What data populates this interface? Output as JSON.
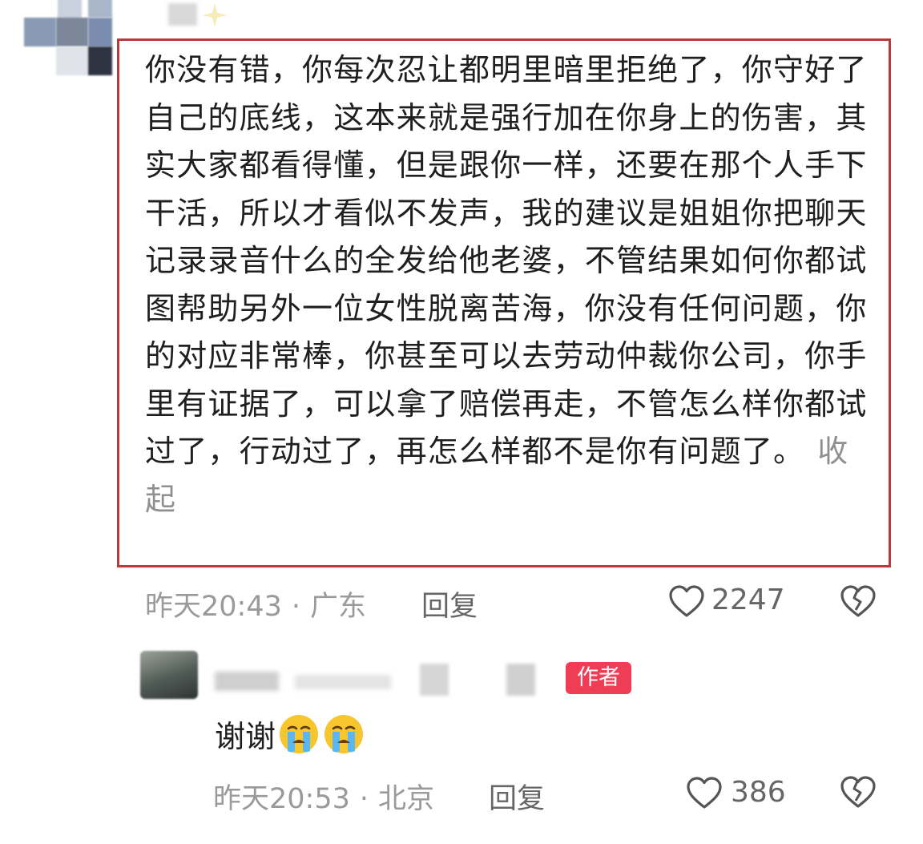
{
  "comment": {
    "text": "你没有错，你每次忍让都明里暗里拒绝了，你守好了自己的底线，这本来就是强行加在你身上的伤害，其实大家都看得懂，但是跟你一样，还要在那个人手下干活，所以才看似不发声，我的建议是姐姐你把聊天记录录音什么的全发给他老婆，不管结果如何你都试图帮助另外一位女性脱离苦海，你没有任何问题，你的对应非常棒，你甚至可以去劳动仲裁你公司，你手里有证据了，可以拿了赔偿再走，不管怎么样你都试过了，行动过了，再怎么样都不是你有问题了。",
    "collapse_label": "收起",
    "time": "昨天20:43",
    "separator": "·",
    "location": "广东",
    "reply_label": "回复",
    "like_count": "2247",
    "highlight_color": "#b83a3a"
  },
  "reply": {
    "badge": "作者",
    "text": "谢谢",
    "emojis": [
      "crying-face-icon",
      "crying-face-icon"
    ],
    "time": "昨天20:53",
    "separator": "·",
    "location": "北京",
    "reply_label": "回复",
    "like_count": "386",
    "badge_color": "#ef3d55"
  }
}
